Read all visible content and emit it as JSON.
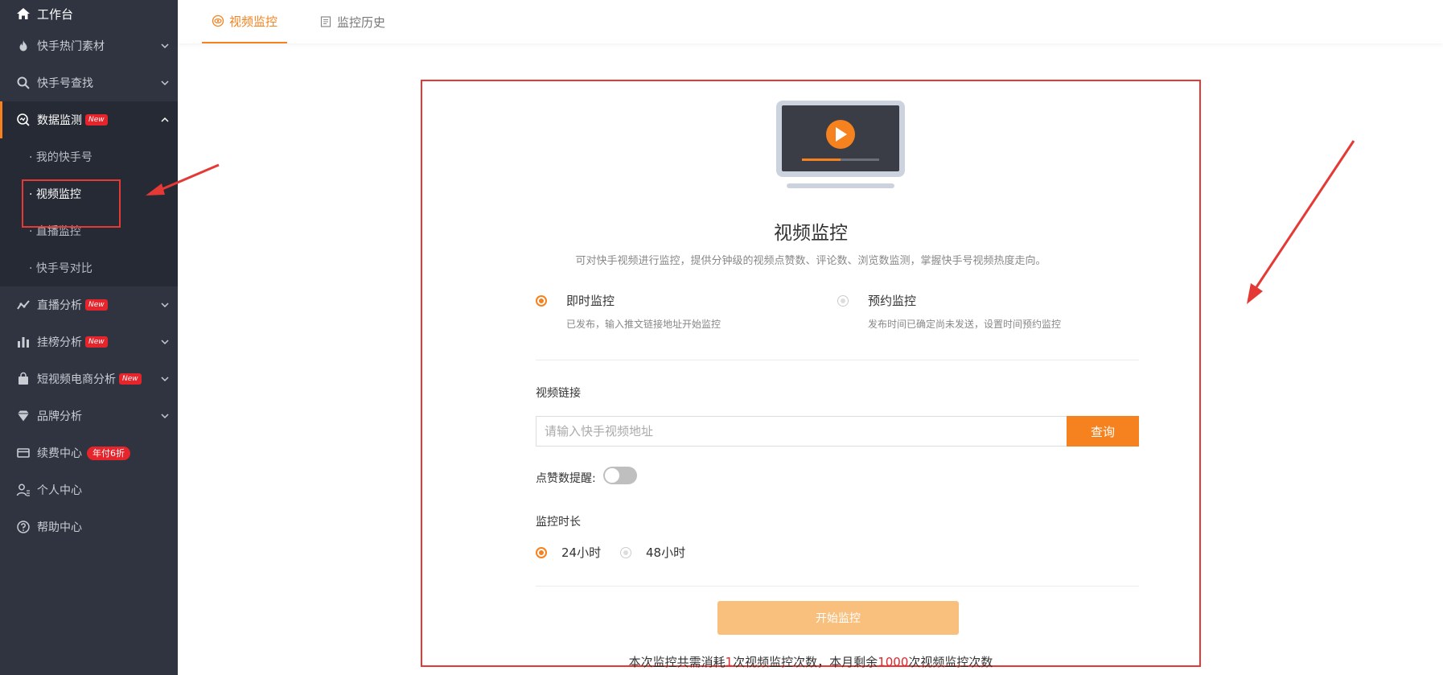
{
  "sidebar": {
    "home": "工作台",
    "items": [
      {
        "label": "快手热门素材"
      },
      {
        "label": "快手号查找"
      },
      {
        "label": "数据监测",
        "badge": "New"
      },
      {
        "label": "直播分析",
        "badge": "New"
      },
      {
        "label": "挂榜分析",
        "badge": "New"
      },
      {
        "label": "短视频电商分析",
        "badge": "New"
      },
      {
        "label": "品牌分析"
      },
      {
        "label": "续费中心",
        "badge": "年付6折"
      },
      {
        "label": "个人中心"
      },
      {
        "label": "帮助中心"
      }
    ],
    "submenu": [
      "· 我的快手号",
      "· 视频监控",
      "· 直播监控",
      "· 快手号对比"
    ]
  },
  "tabs": [
    "视频监控",
    "监控历史"
  ],
  "panel": {
    "title": "视频监控",
    "description": "可对快手视频进行监控，提供分钟级的视频点赞数、评论数、浏览数监测，掌握快手号视频热度走向。",
    "modes": [
      {
        "title": "即时监控",
        "sub": "已发布，输入推文链接地址开始监控",
        "selected": true
      },
      {
        "title": "预约监控",
        "sub": "发布时间已确定尚未发送，设置时间预约监控",
        "selected": false
      }
    ],
    "link_label": "视频链接",
    "input_placeholder": "请输入快手视频地址",
    "query_button": "查询",
    "toggle_label": "点赞数提醒:",
    "duration_label": "监控时长",
    "durations": [
      {
        "label": "24小时",
        "selected": true
      },
      {
        "label": "48小时",
        "selected": false
      }
    ],
    "start_button": "开始监控",
    "footnote": {
      "p1": "本次监控共需消耗",
      "n1": "1",
      "p2": "次视频监控次数，本月剩余",
      "n2": "1000",
      "p3": "次视频监控次数"
    }
  },
  "colors": {
    "accent": "#f5821f",
    "sidebar_bg": "#2f3440",
    "badge_red": "#e5242b",
    "annotation_red": "#e53935"
  }
}
